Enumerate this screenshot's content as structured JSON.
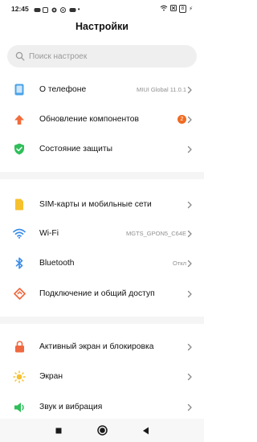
{
  "status_bar": {
    "time": "12:45",
    "battery": "8"
  },
  "header": {
    "title": "Настройки"
  },
  "search": {
    "placeholder": "Поиск настроек"
  },
  "items": [
    {
      "label": "О телефоне",
      "value": "MIUI Global 11.0.1",
      "icon": "phone-info-icon",
      "color": "#4aa3e8"
    },
    {
      "label": "Обновление компонентов",
      "badge": "2",
      "icon": "arrow-up-icon",
      "color": "#f26c3c"
    },
    {
      "label": "Состояние защиты",
      "icon": "shield-check-icon",
      "color": "#2fbf5a"
    },
    {
      "label": "SIM-карты и мобильные сети",
      "icon": "sim-card-icon",
      "color": "#f6c12e"
    },
    {
      "label": "Wi-Fi",
      "value": "MGTS_GPON5_C64E",
      "icon": "wifi-icon",
      "color": "#3b8de8"
    },
    {
      "label": "Bluetooth",
      "value": "Откл",
      "icon": "bluetooth-icon",
      "color": "#3b8de8"
    },
    {
      "label": "Подключение и общий доступ",
      "icon": "connection-sharing-icon",
      "color": "#f0683f"
    },
    {
      "label": "Активный экран и блокировка",
      "icon": "lock-icon",
      "color": "#f0683f"
    },
    {
      "label": "Экран",
      "icon": "sun-icon",
      "color": "#f6c12e"
    },
    {
      "label": "Звук и вибрация",
      "icon": "speaker-icon",
      "color": "#2fbf5a"
    }
  ]
}
